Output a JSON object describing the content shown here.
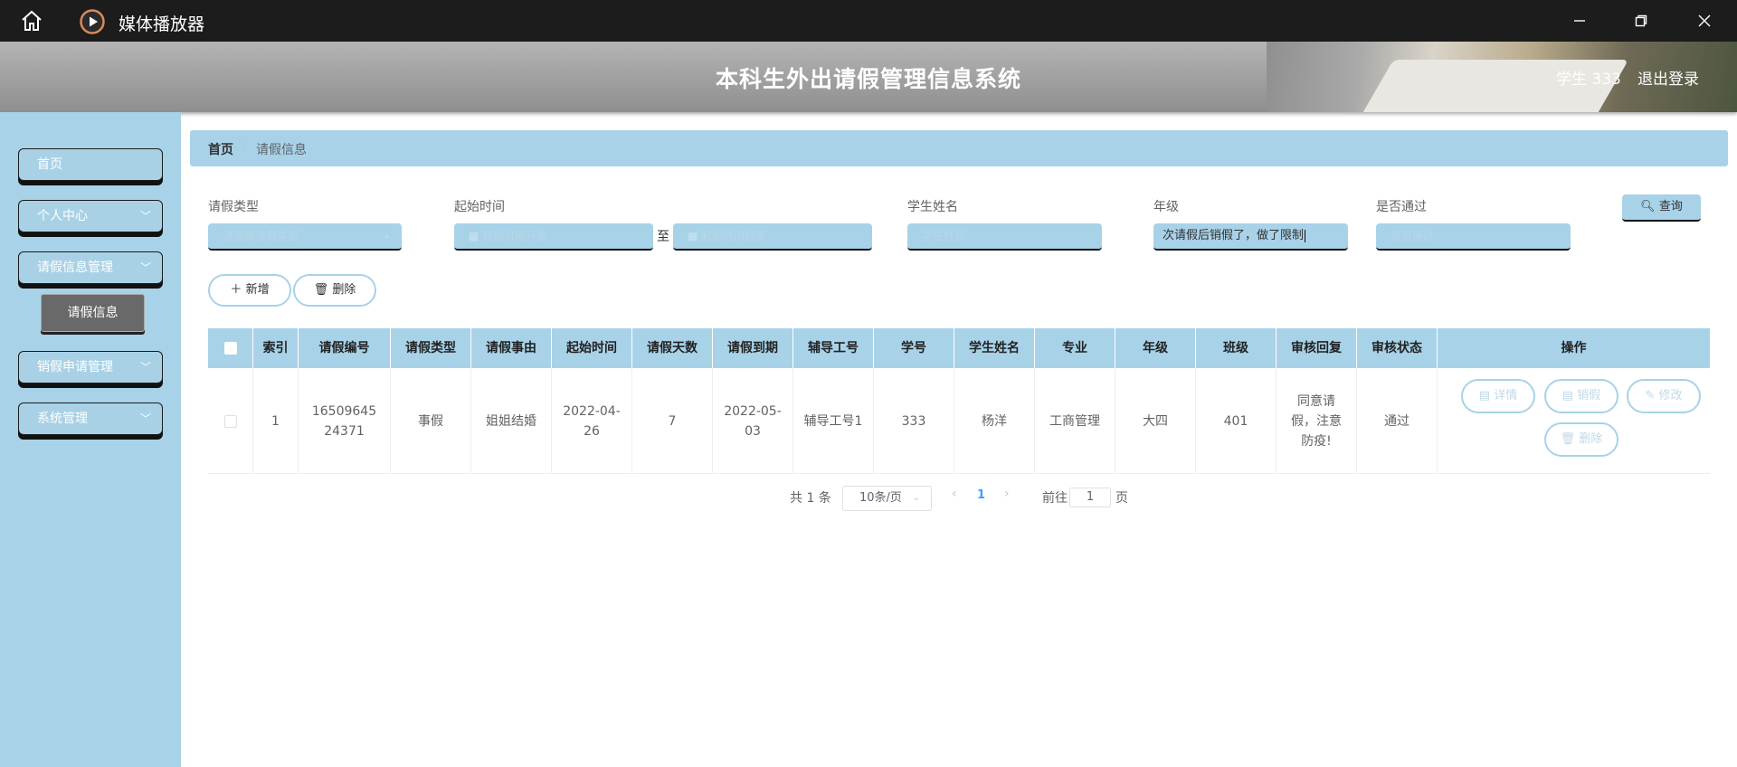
{
  "window": {
    "title": "媒体播放器",
    "icons": [
      "home-icon",
      "media-player-icon",
      "minimize-icon",
      "maximize-icon",
      "close-icon"
    ]
  },
  "header": {
    "title": "本科生外出请假管理信息系统",
    "user": "学生 333",
    "logout": "退出登录"
  },
  "sidebar": {
    "items": [
      {
        "label": "首页"
      },
      {
        "label": "个人中心",
        "chevron": "﹀"
      },
      {
        "label": "请假信息管理",
        "chevron": "﹀"
      },
      {
        "label": "销假申请管理",
        "chevron": "﹀"
      },
      {
        "label": "系统管理",
        "chevron": "﹀"
      }
    ],
    "active_sub": "请假信息"
  },
  "breadcrumb": {
    "home": "首页",
    "sep": "/",
    "current": "请假信息"
  },
  "filters": {
    "leave_type": {
      "label": "请假类型",
      "placeholder": "请选择请假类型"
    },
    "start_time": {
      "label": "起始时间",
      "from_placeholder": "起始时间开始",
      "to": "至",
      "to_placeholder": "起始时间结束"
    },
    "student_name": {
      "label": "学生姓名",
      "placeholder": "学生姓名"
    },
    "grade": {
      "label": "年级",
      "value": "次请假后销假了，做了限制"
    },
    "passed": {
      "label": "是否通过",
      "placeholder": "是否通过"
    },
    "query_button": "查询"
  },
  "actions": {
    "add": "新增",
    "delete": "删除"
  },
  "table": {
    "columns": [
      "索引",
      "请假编号",
      "请假类型",
      "请假事由",
      "起始时间",
      "请假天数",
      "请假到期",
      "辅导工号",
      "学号",
      "学生姓名",
      "专业",
      "年级",
      "班级",
      "审核回复",
      "审核状态",
      "操作"
    ],
    "rows": [
      {
        "index": "1",
        "leave_no": "1650964524371",
        "leave_type": "事假",
        "reason": "姐姐结婚",
        "start_time": "2022-04-26",
        "days": "7",
        "due": "2022-05-03",
        "tutor_no": "辅导工号1",
        "student_no": "333",
        "student_name": "杨洋",
        "major": "工商管理",
        "grade": "大四",
        "class": "401",
        "reply": "同意请假，注意防疫!",
        "status": "通过"
      }
    ],
    "row_actions": {
      "detail": "详情",
      "cancel_leave": "销假",
      "edit": "修改",
      "delete": "删除"
    }
  },
  "pagination": {
    "total": "共 1 条",
    "page_size": "10条/页",
    "prev": "‹",
    "current_page": "1",
    "next": "›",
    "goto_label": "前往",
    "goto_value": "1",
    "goto_unit": "页"
  },
  "colors": {
    "accent": "#a8d2e8",
    "titlebar": "#1c1c1c",
    "header": "#9e9e9e",
    "active_sub": "#696969",
    "page_active": "#409eff"
  }
}
